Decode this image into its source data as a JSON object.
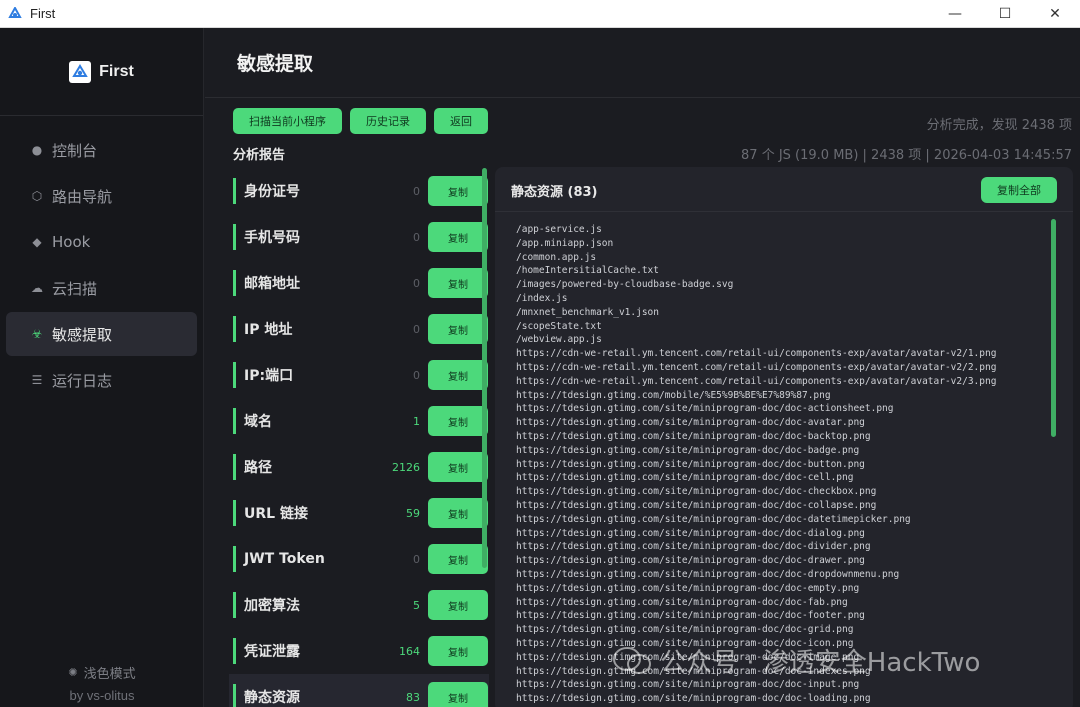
{
  "window": {
    "title": "First",
    "minimize": "—",
    "maximize": "☐",
    "close": "✕"
  },
  "sidebar": {
    "brand": "First",
    "items": [
      {
        "label": "控制台",
        "icon": "dot-icon",
        "glyph": "●"
      },
      {
        "label": "路由导航",
        "icon": "hexagon-icon",
        "glyph": "⬡"
      },
      {
        "label": "Hook",
        "icon": "diamond-icon",
        "glyph": "◆"
      },
      {
        "label": "云扫描",
        "icon": "cloud-icon",
        "glyph": "☁"
      },
      {
        "label": "敏感提取",
        "icon": "biohazard-icon",
        "glyph": "☣",
        "active": true
      },
      {
        "label": "运行日志",
        "icon": "list-icon",
        "glyph": "☰"
      }
    ],
    "theme_toggle": "浅色模式",
    "theme_glyph": "✺",
    "author": "by vs-olitus"
  },
  "main": {
    "title": "敏感提取",
    "toolbar": {
      "scan": "扫描当前小程序",
      "history": "历史记录",
      "back": "返回"
    },
    "status_line1": "分析完成，发现 2438 项",
    "status_line2": "87 个 JS (19.0 MB)  |  2438 项  |  2026-04-03 14:45:57",
    "report_title": "分析报告",
    "copy_label": "复制",
    "categories": [
      {
        "label": "身份证号",
        "count": "0"
      },
      {
        "label": "手机号码",
        "count": "0"
      },
      {
        "label": "邮箱地址",
        "count": "0"
      },
      {
        "label": "IP 地址",
        "count": "0"
      },
      {
        "label": "IP:端口",
        "count": "0"
      },
      {
        "label": "域名",
        "count": "1"
      },
      {
        "label": "路径",
        "count": "2126"
      },
      {
        "label": "URL 链接",
        "count": "59"
      },
      {
        "label": "JWT Token",
        "count": "0"
      },
      {
        "label": "加密算法",
        "count": "5"
      },
      {
        "label": "凭证泄露",
        "count": "164"
      },
      {
        "label": "静态资源",
        "count": "83",
        "active": true
      }
    ],
    "panel": {
      "title": "静态资源 (83)",
      "copy_all": "复制全部",
      "files": [
        "/app-service.js",
        "/app.miniapp.json",
        "/common.app.js",
        "/homeIntersitialCache.txt",
        "/images/powered-by-cloudbase-badge.svg",
        "/index.js",
        "/mnxnet_benchmark_v1.json",
        "/scopeState.txt",
        "/webview.app.js",
        "https://cdn-we-retail.ym.tencent.com/retail-ui/components-exp/avatar/avatar-v2/1.png",
        "https://cdn-we-retail.ym.tencent.com/retail-ui/components-exp/avatar/avatar-v2/2.png",
        "https://cdn-we-retail.ym.tencent.com/retail-ui/components-exp/avatar/avatar-v2/3.png",
        "https://tdesign.gtimg.com/mobile/%E5%9B%BE%E7%89%87.png",
        "https://tdesign.gtimg.com/site/miniprogram-doc/doc-actionsheet.png",
        "https://tdesign.gtimg.com/site/miniprogram-doc/doc-avatar.png",
        "https://tdesign.gtimg.com/site/miniprogram-doc/doc-backtop.png",
        "https://tdesign.gtimg.com/site/miniprogram-doc/doc-badge.png",
        "https://tdesign.gtimg.com/site/miniprogram-doc/doc-button.png",
        "https://tdesign.gtimg.com/site/miniprogram-doc/doc-cell.png",
        "https://tdesign.gtimg.com/site/miniprogram-doc/doc-checkbox.png",
        "https://tdesign.gtimg.com/site/miniprogram-doc/doc-collapse.png",
        "https://tdesign.gtimg.com/site/miniprogram-doc/doc-datetimepicker.png",
        "https://tdesign.gtimg.com/site/miniprogram-doc/doc-dialog.png",
        "https://tdesign.gtimg.com/site/miniprogram-doc/doc-divider.png",
        "https://tdesign.gtimg.com/site/miniprogram-doc/doc-drawer.png",
        "https://tdesign.gtimg.com/site/miniprogram-doc/doc-dropdownmenu.png",
        "https://tdesign.gtimg.com/site/miniprogram-doc/doc-empty.png",
        "https://tdesign.gtimg.com/site/miniprogram-doc/doc-fab.png",
        "https://tdesign.gtimg.com/site/miniprogram-doc/doc-footer.png",
        "https://tdesign.gtimg.com/site/miniprogram-doc/doc-grid.png",
        "https://tdesign.gtimg.com/site/miniprogram-doc/doc-icon.png",
        "https://tdesign.gtimg.com/site/miniprogram-doc/doc-image.png",
        "https://tdesign.gtimg.com/site/miniprogram-doc/doc-indexes.png",
        "https://tdesign.gtimg.com/site/miniprogram-doc/doc-input.png",
        "https://tdesign.gtimg.com/site/miniprogram-doc/doc-loading.png"
      ]
    }
  },
  "watermark": "公众号 · 渗透安全HackTwo",
  "colors": {
    "accent": "#4cd97b",
    "bg": "#1b1c21",
    "sidebar": "#16171b",
    "panel": "#23242b"
  }
}
